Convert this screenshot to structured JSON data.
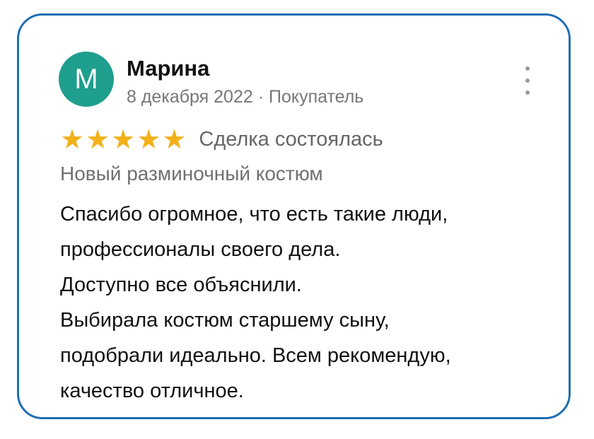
{
  "review": {
    "author": {
      "initial": "М",
      "name": "Марина",
      "avatar_color": "#1e9e8c"
    },
    "meta": "8 декабря 2022 · Покупатель",
    "rating": {
      "stars": 5,
      "max": 5,
      "star_color": "#f2b11a",
      "star_glyph": "★"
    },
    "deal_status": "Сделка состоялась",
    "product": "Новый разминочный костюм",
    "text_lines": [
      "Спасибо огромное, что есть такие люди,",
      "профессионалы своего дела.",
      "Доступно все объяснили.",
      "Выбирала костюм старшему сыну,",
      "подобрали идеально.  Всем рекомендую,",
      "качество отличное."
    ],
    "more_icon": "more-vertical-icon",
    "border_color": "#1f6fb2"
  }
}
